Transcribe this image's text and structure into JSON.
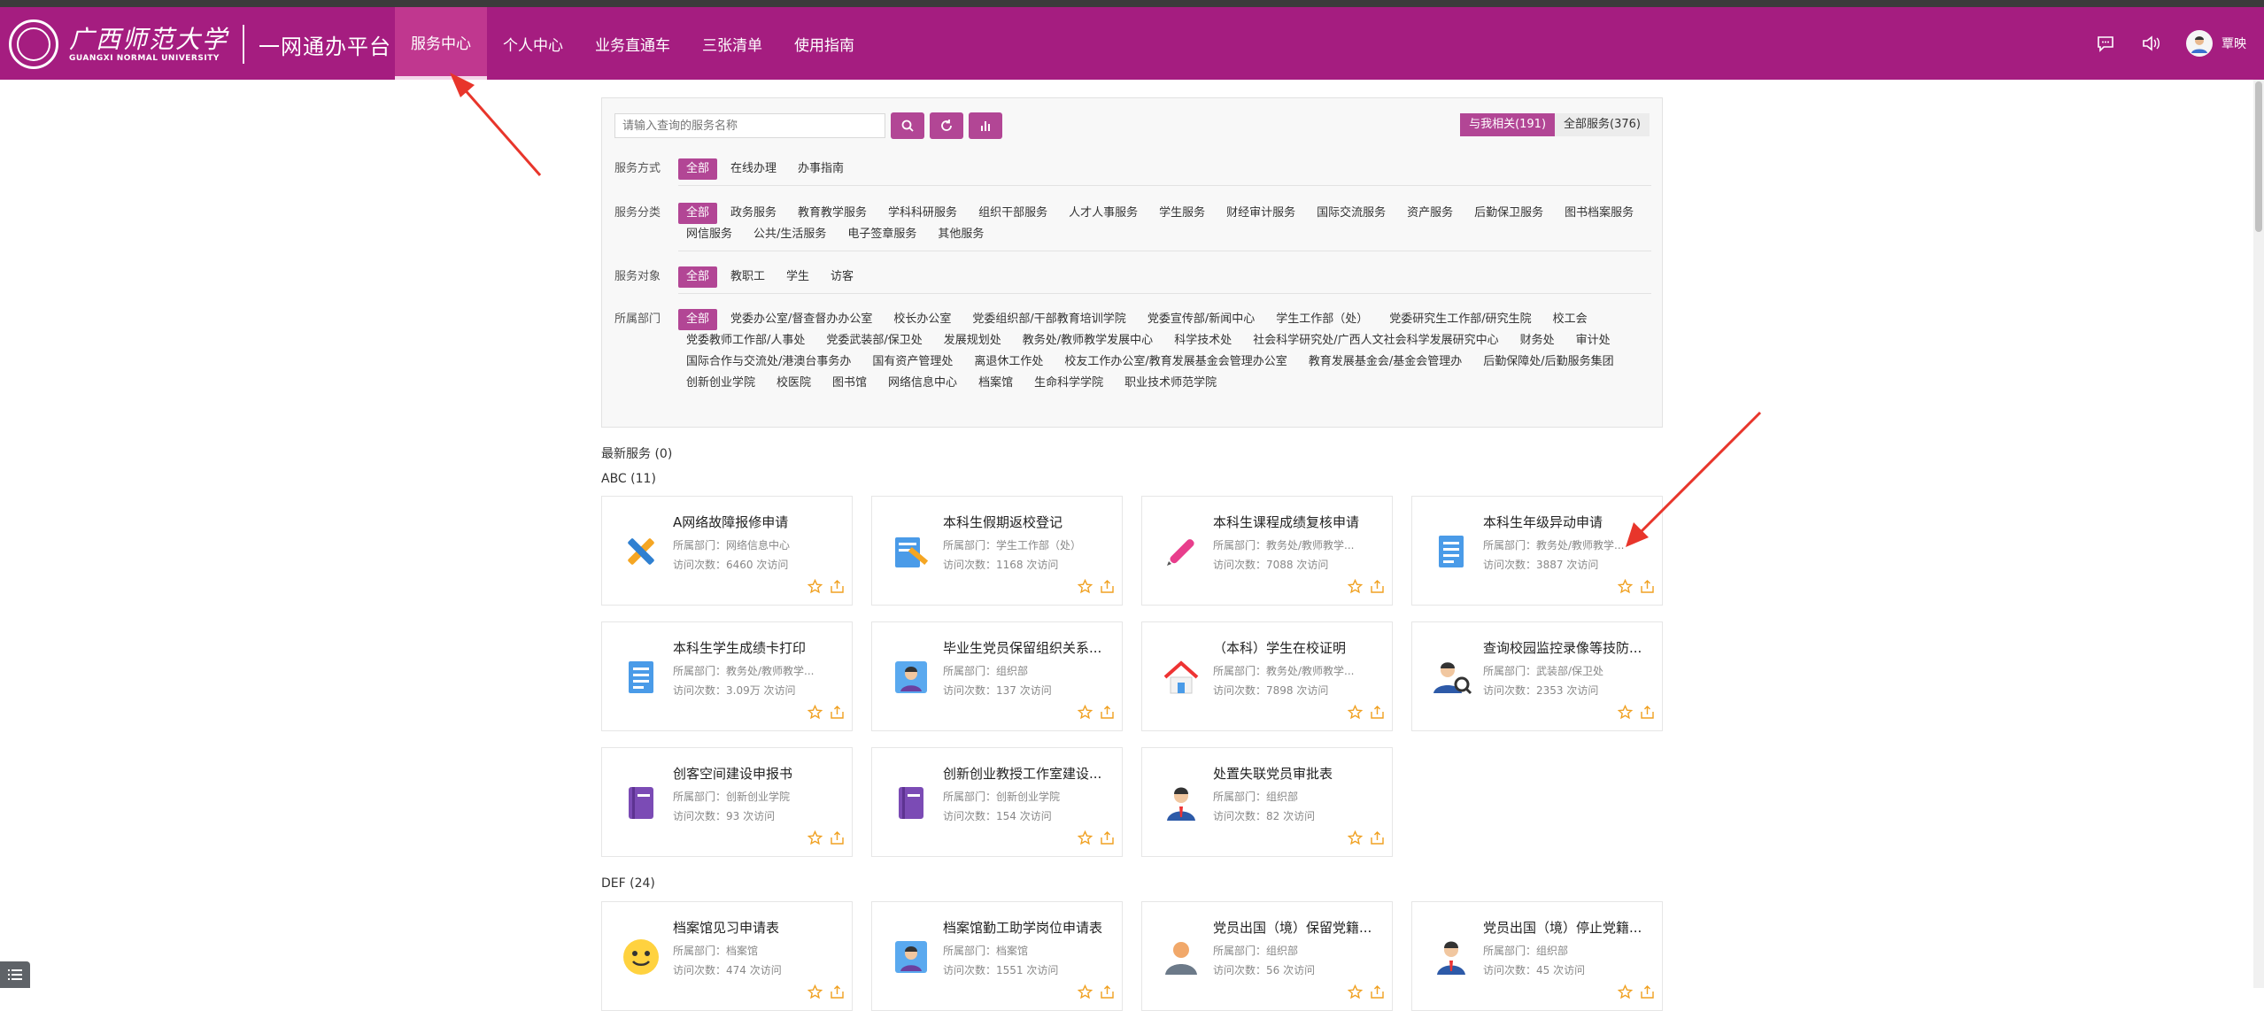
{
  "header": {
    "logo_cn": "广西师范大学",
    "logo_en": "GUANGXI NORMAL UNIVERSITY",
    "platform_title": "一网通办平台",
    "nav": [
      "服务中心",
      "个人中心",
      "业务直通车",
      "三张清单",
      "使用指南"
    ],
    "username": "覃映"
  },
  "search": {
    "placeholder": "请输入查询的服务名称",
    "scope_tabs": [
      "与我相关(191)",
      "全部服务(376)"
    ]
  },
  "filters": {
    "mode": {
      "label": "服务方式",
      "options": [
        "全部",
        "在线办理",
        "办事指南"
      ]
    },
    "category": {
      "label": "服务分类",
      "options": [
        "全部",
        "政务服务",
        "教育教学服务",
        "学科科研服务",
        "组织干部服务",
        "人才人事服务",
        "学生服务",
        "财经审计服务",
        "国际交流服务",
        "资产服务",
        "后勤保卫服务",
        "图书档案服务",
        "网信服务",
        "公共/生活服务",
        "电子签章服务",
        "其他服务"
      ]
    },
    "target": {
      "label": "服务对象",
      "options": [
        "全部",
        "教职工",
        "学生",
        "访客"
      ]
    },
    "dept": {
      "label": "所属部门",
      "options": [
        "全部",
        "党委办公室/督查督办办公室",
        "校长办公室",
        "党委组织部/干部教育培训学院",
        "党委宣传部/新闻中心",
        "学生工作部（处）",
        "党委研究生工作部/研究生院",
        "校工会",
        "党委教师工作部/人事处",
        "党委武装部/保卫处",
        "发展规划处",
        "教务处/教师教学发展中心",
        "科学技术处",
        "社会科学研究处/广西人文社会科学发展研究中心",
        "财务处",
        "审计处",
        "国际合作与交流处/港澳台事务办",
        "国有资产管理处",
        "离退休工作处",
        "校友工作办公室/教育发展基金会管理办公室",
        "教育发展基金会/基金会管理办",
        "后勤保障处/后勤服务集团",
        "创新创业学院",
        "校医院",
        "图书馆",
        "网络信息中心",
        "档案馆",
        "生命科学学院",
        "职业技术师范学院"
      ]
    }
  },
  "sections": {
    "latest": "最新服务 (0)",
    "abc": "ABC (11)",
    "def": "DEF (24)"
  },
  "cards": [
    {
      "title": "A网络故障报修申请",
      "dept": "所属部门：网络信息中心",
      "visits": "访问次数：6460 次访问",
      "icon": "tools-icon"
    },
    {
      "title": "本科生假期返校登记",
      "dept": "所属部门：学生工作部（处）",
      "visits": "访问次数：1168 次访问",
      "icon": "form-pencil-icon"
    },
    {
      "title": "本科生课程成绩复核申请",
      "dept": "所属部门：教务处/教师教学...",
      "visits": "访问次数：7088 次访问",
      "icon": "pen-icon"
    },
    {
      "title": "本科生年级异动申请",
      "dept": "所属部门：教务处/教师教学...",
      "visits": "访问次数：3887 次访问",
      "icon": "document-icon"
    },
    {
      "title": "本科生学生成绩卡打印",
      "dept": "所属部门：教务处/教师教学...",
      "visits": "访问次数：3.09万 次访问",
      "icon": "document-icon"
    },
    {
      "title": "毕业生党员保留组织关系...",
      "dept": "所属部门：组织部",
      "visits": "访问次数：137 次访问",
      "icon": "person-card-icon"
    },
    {
      "title": "（本科）学生在校证明",
      "dept": "所属部门：教务处/教师教学...",
      "visits": "访问次数：7898 次访问",
      "icon": "house-icon"
    },
    {
      "title": "查询校园监控录像等技防...",
      "dept": "所属部门：武装部/保卫处",
      "visits": "访问次数：2353 次访问",
      "icon": "person-search-icon"
    },
    {
      "title": "创客空间建设申报书",
      "dept": "所属部门：创新创业学院",
      "visits": "访问次数：93 次访问",
      "icon": "book-icon"
    },
    {
      "title": "创新创业教授工作室建设...",
      "dept": "所属部门：创新创业学院",
      "visits": "访问次数：154 次访问",
      "icon": "book-icon"
    },
    {
      "title": "处置失联党员审批表",
      "dept": "所属部门：组织部",
      "visits": "访问次数：82 次访问",
      "icon": "person-tie-icon"
    },
    {
      "title": "档案馆见习申请表",
      "dept": "所属部门：档案馆",
      "visits": "访问次数：474 次访问",
      "icon": "smiley-icon"
    },
    {
      "title": "档案馆勤工助学岗位申请表",
      "dept": "所属部门：档案馆",
      "visits": "访问次数：1551 次访问",
      "icon": "person-card-icon"
    },
    {
      "title": "党员出国（境）保留党籍...",
      "dept": "所属部门：组织部",
      "visits": "访问次数：56 次访问",
      "icon": "person-gray-icon"
    },
    {
      "title": "党员出国（境）停止党籍...",
      "dept": "所属部门：组织部",
      "visits": "访问次数：45 次访问",
      "icon": "person-tie-icon"
    }
  ],
  "colors": {
    "brand": "#a51d80",
    "accent": "#b24695",
    "arrow": "#e8352b",
    "star": "#f0a020"
  }
}
